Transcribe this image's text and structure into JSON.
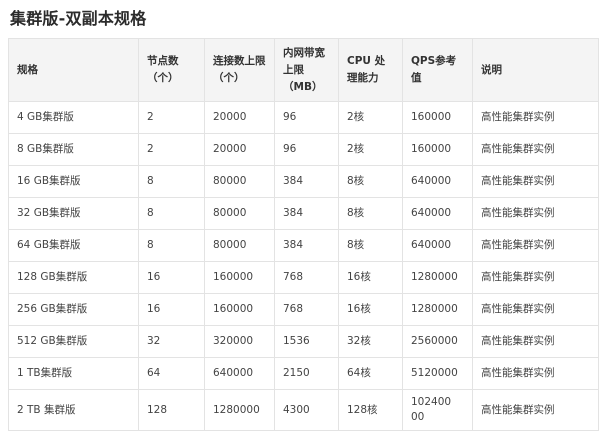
{
  "page": {
    "title": "集群版-双副本规格"
  },
  "table": {
    "headers": [
      "规格",
      "节点数（个）",
      "连接数上限（个）",
      "内网带宽上限（MB）",
      "CPU 处理能力",
      "QPS参考值",
      "说明"
    ],
    "rows": [
      [
        "4 GB集群版",
        "2",
        "20000",
        "96",
        "2核",
        "160000",
        "高性能集群实例"
      ],
      [
        "8 GB集群版",
        "2",
        "20000",
        "96",
        "2核",
        "160000",
        "高性能集群实例"
      ],
      [
        "16 GB集群版",
        "8",
        "80000",
        "384",
        "8核",
        "640000",
        "高性能集群实例"
      ],
      [
        "32 GB集群版",
        "8",
        "80000",
        "384",
        "8核",
        "640000",
        "高性能集群实例"
      ],
      [
        "64 GB集群版",
        "8",
        "80000",
        "384",
        "8核",
        "640000",
        "高性能集群实例"
      ],
      [
        "128 GB集群版",
        "16",
        "160000",
        "768",
        "16核",
        "1280000",
        "高性能集群实例"
      ],
      [
        "256 GB集群版",
        "16",
        "160000",
        "768",
        "16核",
        "1280000",
        "高性能集群实例"
      ],
      [
        "512 GB集群版",
        "32",
        "320000",
        "1536",
        "32核",
        "2560000",
        "高性能集群实例"
      ],
      [
        "1 TB集群版",
        "64",
        "640000",
        "2150",
        "64核",
        "5120000",
        "高性能集群实例"
      ],
      [
        "2 TB 集群版",
        "128",
        "1280000",
        "4300",
        "128核",
        "10240000",
        "高性能集群实例"
      ]
    ]
  }
}
